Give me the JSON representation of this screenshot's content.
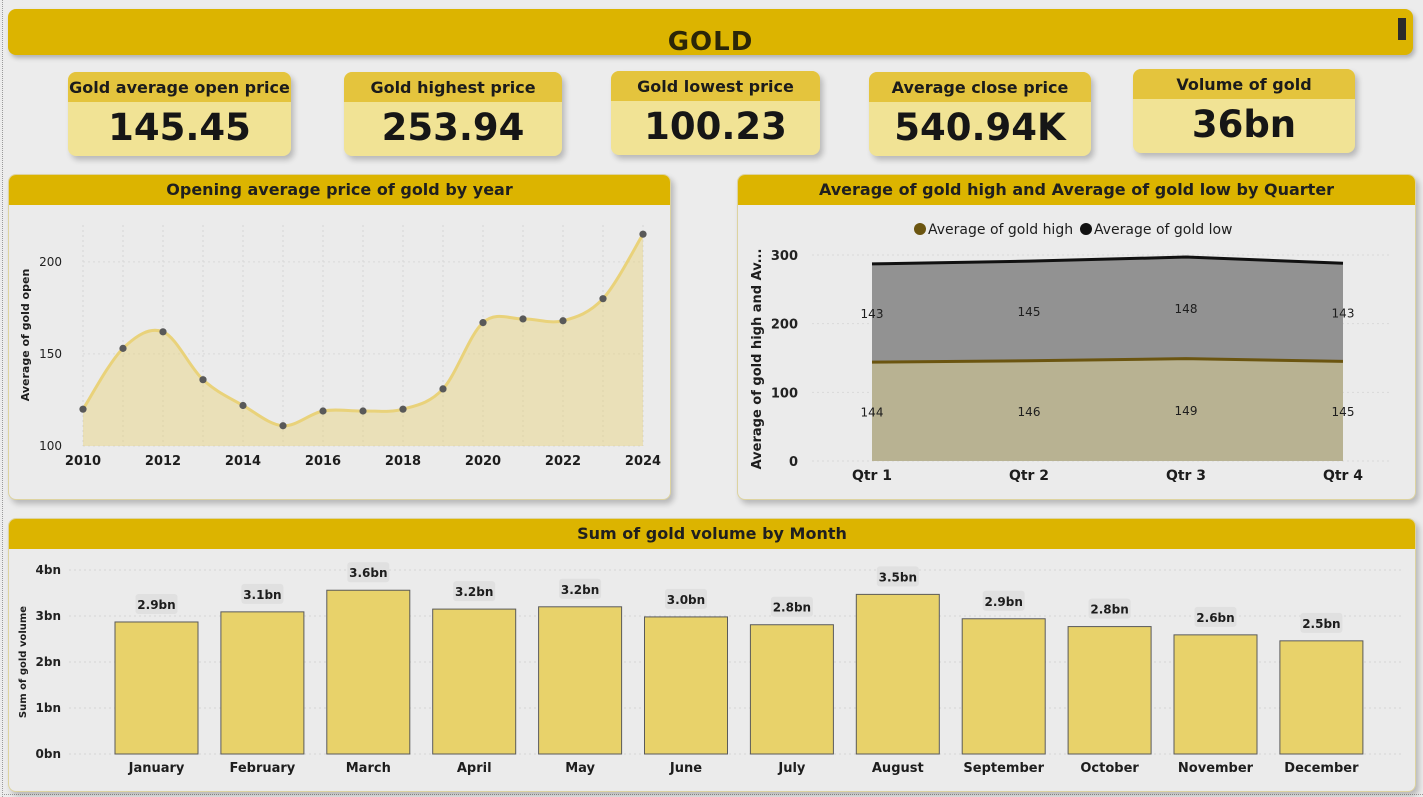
{
  "header": {
    "title": "GOLD"
  },
  "kpis": [
    {
      "label": "Gold average open price",
      "value": "145.45"
    },
    {
      "label": "Gold highest price",
      "value": "253.94"
    },
    {
      "label": "Gold lowest price",
      "value": "100.23"
    },
    {
      "label": "Average close price",
      "value": "540.94K"
    },
    {
      "label": "Volume of gold",
      "value": "36bn"
    }
  ],
  "colors": {
    "gold": "#dcb400",
    "kpi_fill": "#f1e395",
    "line_gold": "#e9d27a",
    "high_fill": "#b8b292",
    "low_band": "#929292",
    "high_line": "#6b5510",
    "bar_fill": "#e8d26a"
  },
  "charts": {
    "opening": {
      "title": "Opening average price of gold by year"
    },
    "quarter": {
      "title": "Average of gold high and Average of gold low by Quarter"
    },
    "volume": {
      "title": "Sum of gold volume by Month"
    }
  },
  "chart_data": [
    {
      "type": "area",
      "title": "Opening average price of gold by year",
      "xlabel": "",
      "ylabel": "Average of gold open",
      "x": [
        2010,
        2011,
        2012,
        2013,
        2014,
        2015,
        2016,
        2017,
        2018,
        2019,
        2020,
        2021,
        2022,
        2023,
        2024
      ],
      "values": [
        120,
        153,
        162,
        136,
        122,
        111,
        119,
        119,
        120,
        131,
        167,
        169,
        168,
        180,
        215
      ],
      "xticks": [
        "2010",
        "2012",
        "2014",
        "2016",
        "2018",
        "2020",
        "2022",
        "2024"
      ],
      "yticks": [
        "100",
        "150",
        "200"
      ],
      "ylim": [
        100,
        220
      ],
      "grid": true
    },
    {
      "type": "area",
      "title": "Average of gold high and Average of gold low by Quarter",
      "ylabel": "Average of gold high and Av...",
      "categories": [
        "Qtr 1",
        "Qtr 2",
        "Qtr 3",
        "Qtr 4"
      ],
      "yticks": [
        "0",
        "100",
        "200",
        "300"
      ],
      "ylim": [
        0,
        300
      ],
      "legend_position": "top",
      "series": [
        {
          "name": "Average of gold high",
          "values": [
            144,
            146,
            149,
            145
          ],
          "labels": [
            "144",
            "146",
            "149",
            "145"
          ],
          "color": "#6b5510"
        },
        {
          "name": "Average of gold low",
          "values": [
            143,
            145,
            148,
            143
          ],
          "labels": [
            "143",
            "145",
            "148",
            "143"
          ],
          "color": "#111111"
        }
      ]
    },
    {
      "type": "bar",
      "title": "Sum of gold volume by Month",
      "ylabel": "Sum of gold volume",
      "categories": [
        "January",
        "February",
        "March",
        "April",
        "May",
        "June",
        "July",
        "August",
        "September",
        "October",
        "November",
        "December"
      ],
      "values": [
        2.87,
        3.09,
        3.56,
        3.15,
        3.2,
        2.98,
        2.81,
        3.47,
        2.94,
        2.77,
        2.59,
        2.46
      ],
      "labels": [
        "2.9bn",
        "3.1bn",
        "3.6bn",
        "3.2bn",
        "3.2bn",
        "3.0bn",
        "2.8bn",
        "3.5bn",
        "2.9bn",
        "2.8bn",
        "2.6bn",
        "2.5bn"
      ],
      "yticks": [
        "0bn",
        "1bn",
        "2bn",
        "3bn",
        "4bn"
      ],
      "ylim": [
        0,
        4
      ],
      "grid": true
    }
  ]
}
